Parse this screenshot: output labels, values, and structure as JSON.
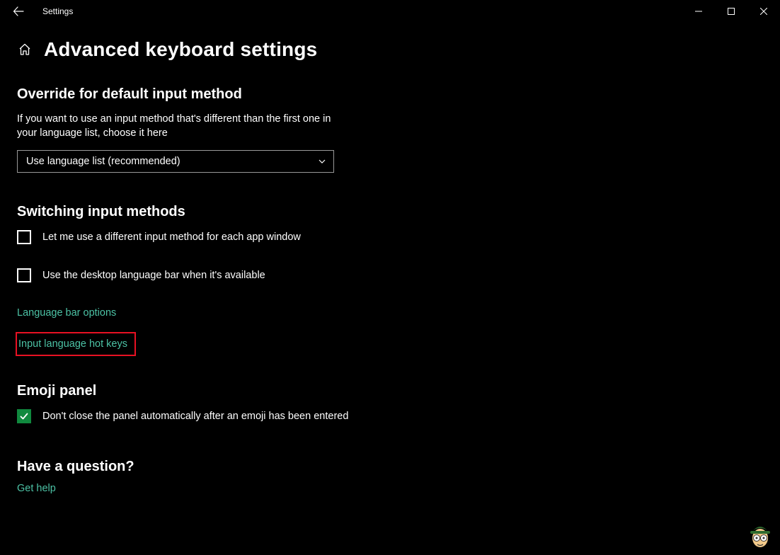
{
  "window": {
    "title": "Settings"
  },
  "page": {
    "title": "Advanced keyboard settings"
  },
  "override": {
    "heading": "Override for default input method",
    "description": "If you want to use an input method that's different than the first one in your language list, choose it here",
    "dropdown_value": "Use language list (recommended)"
  },
  "switching": {
    "heading": "Switching input methods",
    "checkbox1_label": "Let me use a different input method for each app window",
    "checkbox1_checked": false,
    "checkbox2_label": "Use the desktop language bar when it's available",
    "checkbox2_checked": false,
    "link1": "Language bar options",
    "link2": "Input language hot keys"
  },
  "emoji": {
    "heading": "Emoji panel",
    "checkbox_label": "Don't close the panel automatically after an emoji has been entered",
    "checkbox_checked": true
  },
  "question": {
    "heading": "Have a question?",
    "link": "Get help"
  }
}
